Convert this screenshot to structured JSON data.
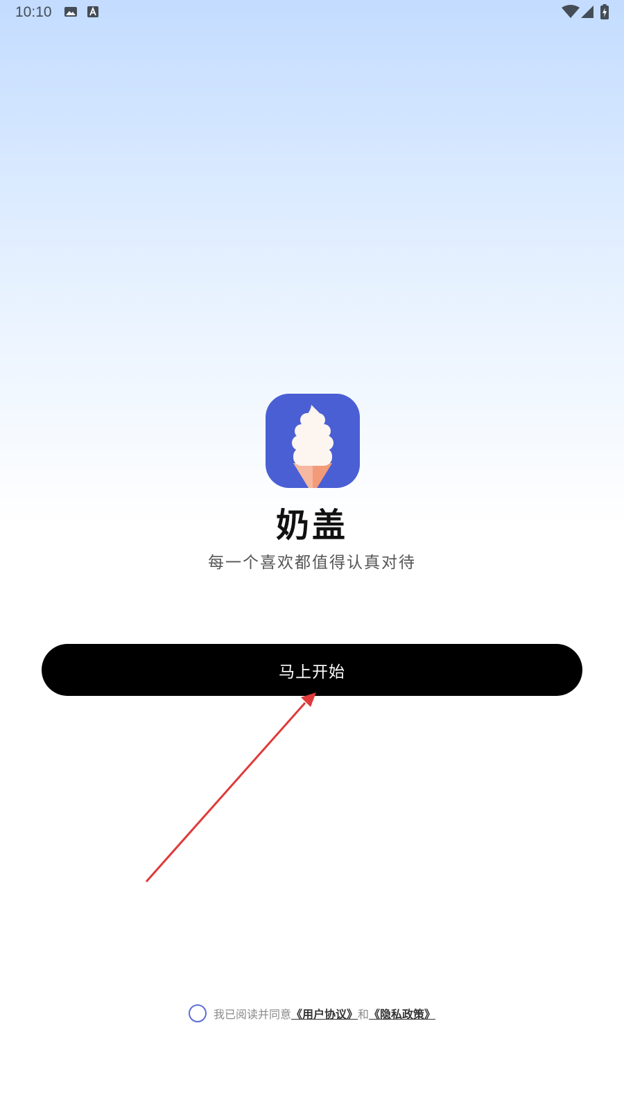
{
  "status_bar": {
    "time": "10:10",
    "icons": [
      "image-icon",
      "font-a-icon",
      "wifi-icon",
      "cellular-signal-icon",
      "battery-charging-icon"
    ]
  },
  "app": {
    "icon": "ice-cream-cone-icon",
    "name": "奶盖",
    "tagline": "每一个喜欢都值得认真对待",
    "brand_color": "#4a5fd4"
  },
  "start_button": {
    "label": "马上开始"
  },
  "annotation": {
    "type": "red-arrow",
    "color": "#e03a3a"
  },
  "agreement": {
    "prefix": "我已阅读并同意",
    "user_agreement": "《用户协议》",
    "conjunction": "和",
    "privacy_policy": "《隐私政策》",
    "checked": false
  }
}
